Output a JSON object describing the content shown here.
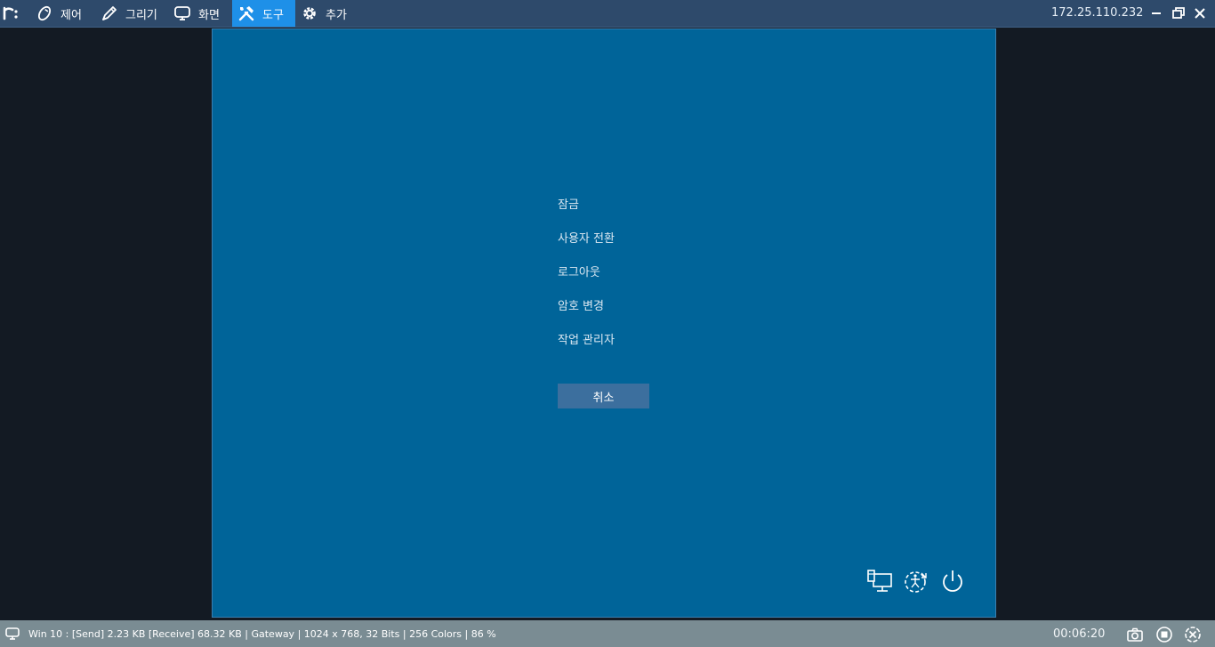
{
  "toolbar": {
    "menus": [
      {
        "label": "제어",
        "icon": "control-icon"
      },
      {
        "label": "그리기",
        "icon": "pen-icon"
      },
      {
        "label": "화면",
        "icon": "monitor-icon"
      },
      {
        "label": "도구",
        "icon": "tools-icon",
        "active": true
      },
      {
        "label": "추가",
        "icon": "gear-icon"
      }
    ],
    "ip": "172.25.110.232",
    "active_color": "#1e90e8"
  },
  "remote": {
    "options": [
      "잠금",
      "사용자 전환",
      "로그아웃",
      "암호 변경",
      "작업 관리자"
    ],
    "cancel_label": "취소",
    "background": "#006499"
  },
  "statusbar": {
    "text": "Win 10 : [Send] 2.23 KB  [Receive] 68.32 KB | Gateway | 1024 x 768, 32 Bits | 256 Colors | 86 %",
    "elapsed": "00:06:20"
  }
}
